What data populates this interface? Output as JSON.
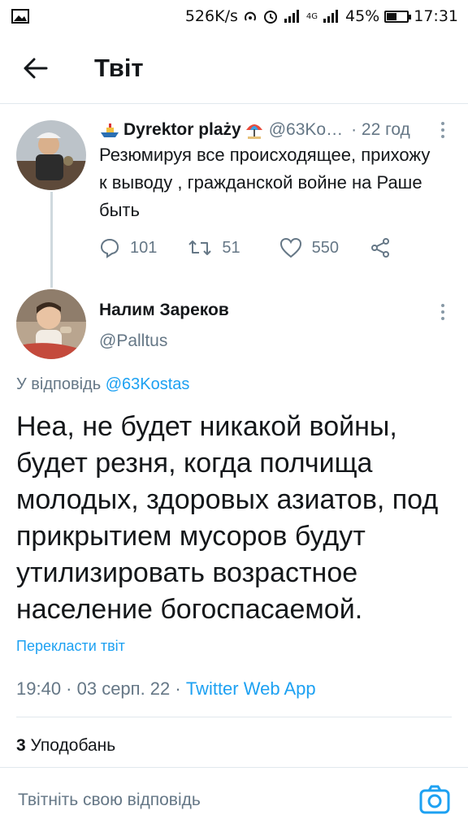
{
  "status_bar": {
    "speed": "526K/s",
    "network_small": "4G",
    "battery": "45%",
    "battery_level": 0.45,
    "time": "17:31"
  },
  "header": {
    "title": "Твіт"
  },
  "parent_tweet": {
    "name": "Dyrektor plaży",
    "handle": "@63Ko…",
    "time": "· 22 год",
    "text": "Резюмируя все происходящее, прихожу к выводу , гражданской войне на Раше быть",
    "replies": "101",
    "retweets": "51",
    "likes": "550"
  },
  "main_tweet": {
    "name": "Налим Зареков",
    "handle": "@Palltus",
    "reply_prefix": "У відповідь",
    "reply_handle": "@63Kostas",
    "text": "Неа, не будет никакой войны, будет резня, когда полчища молодых, здоровых азиатов, под прикрытием мусоров будут утилизировать возрастное население богоспасаемой.",
    "translate": "Перекласти твіт",
    "timestamp": "19:40 · 03 серп. 22 · ",
    "source": "Twitter Web App",
    "likes_count": "3",
    "likes_label": "Уподобань"
  },
  "reply_bar": {
    "placeholder": "Твітніть свою відповідь"
  },
  "colors": {
    "accent": "#1da1f2",
    "secondary": "#657786",
    "divider": "#e1e8ed"
  }
}
